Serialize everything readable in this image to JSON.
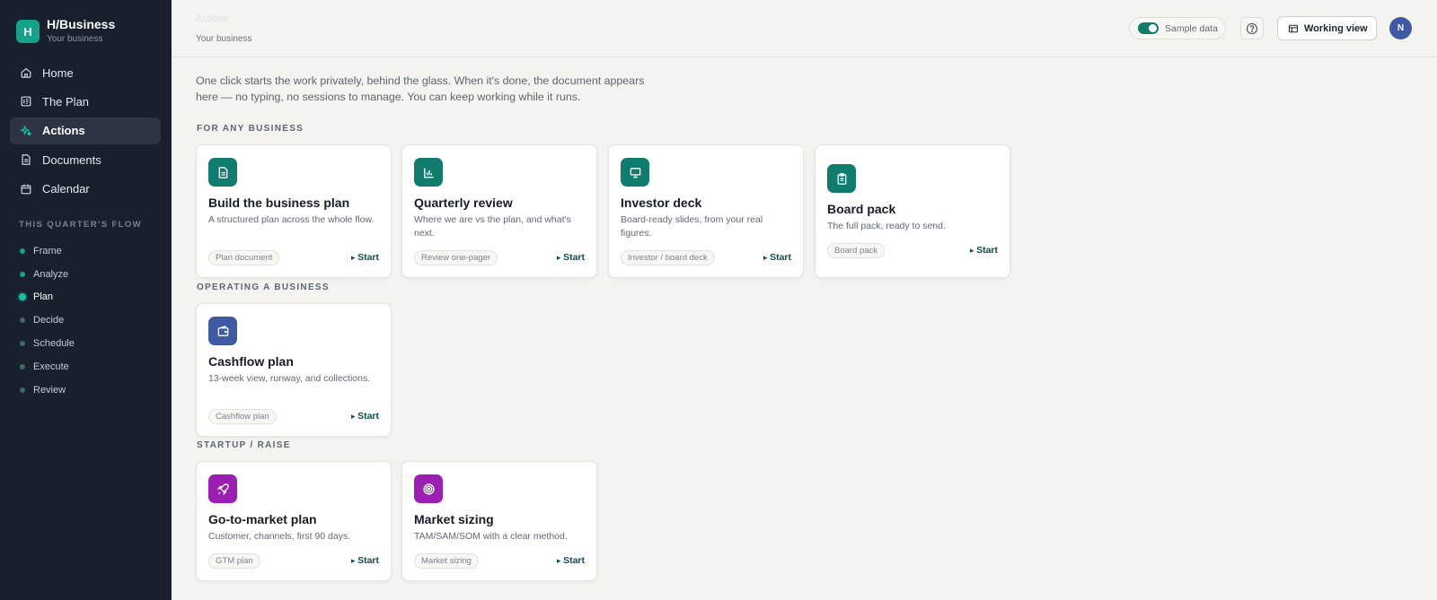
{
  "app": {
    "name": "H/Business",
    "logo_letter": "H",
    "subtitle": "Your business"
  },
  "nav": [
    {
      "label": "Home",
      "icon": "home-icon",
      "active": false
    },
    {
      "label": "The Plan",
      "icon": "plan-icon",
      "active": false
    },
    {
      "label": "Actions",
      "icon": "sparkle-icon",
      "active": true
    },
    {
      "label": "Documents",
      "icon": "document-icon",
      "active": false
    },
    {
      "label": "Calendar",
      "icon": "calendar-icon",
      "active": false
    }
  ],
  "flow": {
    "title": "THIS QUARTER'S FLOW",
    "items": [
      {
        "label": "Frame",
        "color": "#14a38a",
        "current": false
      },
      {
        "label": "Analyze",
        "color": "#14a38a",
        "current": false
      },
      {
        "label": "Plan",
        "color": "#14c4a6",
        "current": true
      },
      {
        "label": "Decide",
        "color": "#3c6b60",
        "current": false
      },
      {
        "label": "Schedule",
        "color": "#3c6b60",
        "current": false
      },
      {
        "label": "Execute",
        "color": "#3c6b60",
        "current": false
      },
      {
        "label": "Review",
        "color": "#3c6b60",
        "current": false
      }
    ]
  },
  "header": {
    "breadcrumb": "Actions",
    "subtitle": "Your business",
    "sample_toggle_label": "Sample data",
    "sample_toggle_on": true,
    "working_view_label": "Working view",
    "avatar_initial": "N"
  },
  "intro": "One click starts the work privately, behind the glass. When it's done, the document appears here — no typing, no sessions to manage. You can keep working while it runs.",
  "sections": [
    {
      "title": "FOR ANY BUSINESS",
      "cards": [
        {
          "title": "Build the business plan",
          "desc": "A structured plan across the whole flow.",
          "chip": "Plan document",
          "start": "Start",
          "icon": "document-icon",
          "color": "#0f7c6d"
        },
        {
          "title": "Quarterly review",
          "desc": "Where we are vs the plan, and what's next.",
          "chip": "Review one-pager",
          "start": "Start",
          "icon": "bar-chart-icon",
          "color": "#0f7c6d"
        },
        {
          "title": "Investor deck",
          "desc": "Board-ready slides, from your real figures.",
          "chip": "Investor / board deck",
          "start": "Start",
          "icon": "presentation-icon",
          "color": "#0f7c6d"
        },
        {
          "title": "Board pack",
          "desc": "The full pack, ready to send.",
          "chip": "Board pack",
          "start": "Start",
          "icon": "clipboard-icon",
          "color": "#0f7c6d"
        }
      ]
    },
    {
      "title": "OPERATING A BUSINESS",
      "cards": [
        {
          "title": "Cashflow plan",
          "desc": "13-week view, runway, and collections.",
          "chip": "Cashflow plan",
          "start": "Start",
          "icon": "wallet-icon",
          "color": "#3f5aa3"
        }
      ]
    },
    {
      "title": "STARTUP / RAISE",
      "cards": [
        {
          "title": "Go-to-market plan",
          "desc": "Customer, channels, first 90 days.",
          "chip": "GTM plan",
          "start": "Start",
          "icon": "rocket-icon",
          "color": "#9b1fb3"
        },
        {
          "title": "Market sizing",
          "desc": "TAM/SAM/SOM with a clear method.",
          "chip": "Market sizing",
          "start": "Start",
          "icon": "target-icon",
          "color": "#9b1fb3"
        }
      ]
    }
  ]
}
